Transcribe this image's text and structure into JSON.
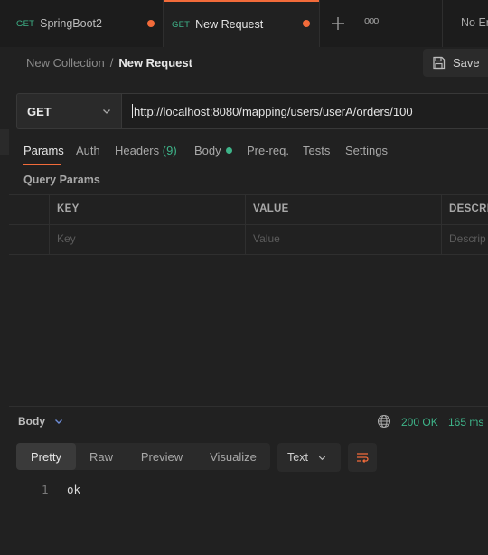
{
  "tabs": [
    {
      "method": "GET",
      "name": "SpringBoot2"
    },
    {
      "method": "GET",
      "name": "New Request"
    }
  ],
  "overflow_label": "ooo",
  "env_label": "No En",
  "breadcrumb": {
    "collection": "New Collection",
    "separator": "/",
    "request": "New Request"
  },
  "save_label": "Save",
  "request": {
    "method": "GET",
    "url": "http://localhost:8080/mapping/users/userA/orders/100"
  },
  "request_tabs": {
    "params": "Params",
    "auth": "Auth",
    "headers": "Headers",
    "headers_count": "(9)",
    "body": "Body",
    "prereq": "Pre-req.",
    "tests": "Tests",
    "settings": "Settings"
  },
  "query_params": {
    "title": "Query Params",
    "columns": [
      "KEY",
      "VALUE",
      "DESCRI"
    ],
    "placeholders": [
      "Key",
      "Value",
      "Descrip"
    ]
  },
  "response": {
    "label": "Body",
    "status": "200 OK",
    "time": "165 ms",
    "views": [
      "Pretty",
      "Raw",
      "Preview",
      "Visualize"
    ],
    "format": "Text",
    "lines": [
      {
        "num": "1",
        "text": "ok"
      }
    ]
  },
  "colors": {
    "accent": "#f26b3a",
    "method_get": "#3eb489",
    "status_ok": "#3eb489",
    "body_dot": "#3eb489"
  }
}
